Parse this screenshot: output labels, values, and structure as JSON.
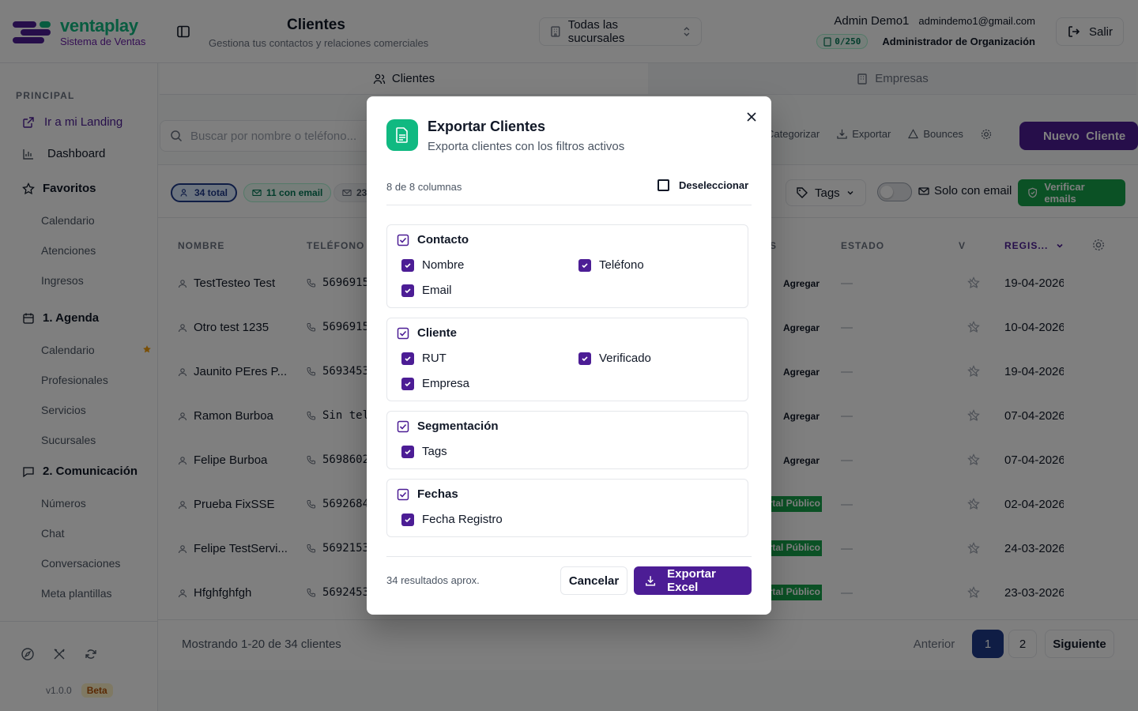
{
  "brand": {
    "name": "ventaplay",
    "subtitle": "Sistema de Ventas"
  },
  "header": {
    "title": "Clientes",
    "subtitle": "Gestiona tus contactos y relaciones comerciales",
    "branch_select": "Todas las sucursales",
    "user_name": "Admin Demo1",
    "user_email": "admindemo1@gmail.com",
    "quota": "0/250",
    "role": "Administrador de Organización",
    "logout_label": "Salir"
  },
  "sidebar": {
    "section": "PRINCIPAL",
    "landing": "Ir a mi Landing",
    "dashboard": "Dashboard",
    "favorites": {
      "label": "Favoritos",
      "items": [
        "Calendario",
        "Atenciones",
        "Ingresos"
      ]
    },
    "agenda": {
      "label": "1. Agenda",
      "items": [
        "Calendario",
        "Profesionales",
        "Servicios",
        "Sucursales"
      ]
    },
    "comunicacion": {
      "label": "2. Comunicación",
      "items": [
        "Números",
        "Chat",
        "Conversaciones",
        "Meta plantillas"
      ]
    },
    "version": "v1.0.0",
    "beta": "Beta"
  },
  "tabs": [
    {
      "label": "Clientes"
    },
    {
      "label": "Empresas"
    }
  ],
  "toolbar": {
    "search_placeholder": "Buscar por nombre o teléfono...",
    "categorize": "Categorizar",
    "export": "Exportar",
    "bounces": "Bounces",
    "new_client": "Nuevo  Cliente"
  },
  "filters": {
    "total": "34 total",
    "with_email": "11 con email",
    "other": "23",
    "tags": "Tags",
    "only_email": "Solo con email",
    "verify": "Verificar emails"
  },
  "table": {
    "headers": {
      "name": "NOMBRE",
      "phone": "TELÉFONO",
      "partial": "S",
      "status": "ESTADO",
      "v": "V",
      "registered": "REGIS..."
    },
    "rows": [
      {
        "name": "TestTesteo Test",
        "phone": "5696915",
        "action": "Agregar",
        "status": "—",
        "date": "19-04-2026"
      },
      {
        "name": "Otro test 1235",
        "phone": "5696915",
        "action": "Agregar",
        "status": "—",
        "date": "10-04-2026"
      },
      {
        "name": "Jaunito PEres P...",
        "phone": "5693453",
        "action": "Agregar",
        "status": "—",
        "date": "19-04-2026"
      },
      {
        "name": "Ramon Burboa",
        "phone": "Sin tel",
        "action": "Agregar",
        "status": "—",
        "date": "07-04-2026"
      },
      {
        "name": "Felipe Burboa",
        "phone": "5698602",
        "action": "Agregar",
        "status": "—",
        "date": "07-04-2026"
      },
      {
        "name": "Prueba FixSSE",
        "phone": "5692684",
        "action": "rtal Público",
        "status": "—",
        "date": "02-04-2026"
      },
      {
        "name": "Felipe TestServi...",
        "phone": "5692153",
        "action": "rtal Público",
        "status": "—",
        "date": "24-03-2026"
      },
      {
        "name": "Hfghfghfgh",
        "phone": "5692453",
        "action": "rtal Público",
        "status": "—",
        "date": "23-03-2026"
      }
    ]
  },
  "pagination": {
    "info": "Mostrando 1-20 de 34 clientes",
    "prev": "Anterior",
    "page1": "1",
    "page2": "2",
    "next": "Siguiente"
  },
  "modal": {
    "title": "Exportar Clientes",
    "subtitle": "Exporta clientes con los filtros activos",
    "column_count": "8 de 8 columnas",
    "deselect": "Deseleccionar",
    "groups": {
      "contacto": {
        "label": "Contacto",
        "options": [
          "Nombre",
          "Teléfono",
          "Email"
        ]
      },
      "cliente": {
        "label": "Cliente",
        "options": [
          "RUT",
          "Verificado",
          "Empresa"
        ]
      },
      "segmentacion": {
        "label": "Segmentación",
        "options": [
          "Tags"
        ]
      },
      "fechas": {
        "label": "Fechas",
        "options": [
          "Fecha Registro"
        ]
      }
    },
    "results": "34 resultados aprox.",
    "cancel": "Cancelar",
    "export": "Exportar Excel"
  },
  "colors": {
    "primary": "#4c1d95",
    "success": "#10b981",
    "verify": "#16a34a"
  }
}
